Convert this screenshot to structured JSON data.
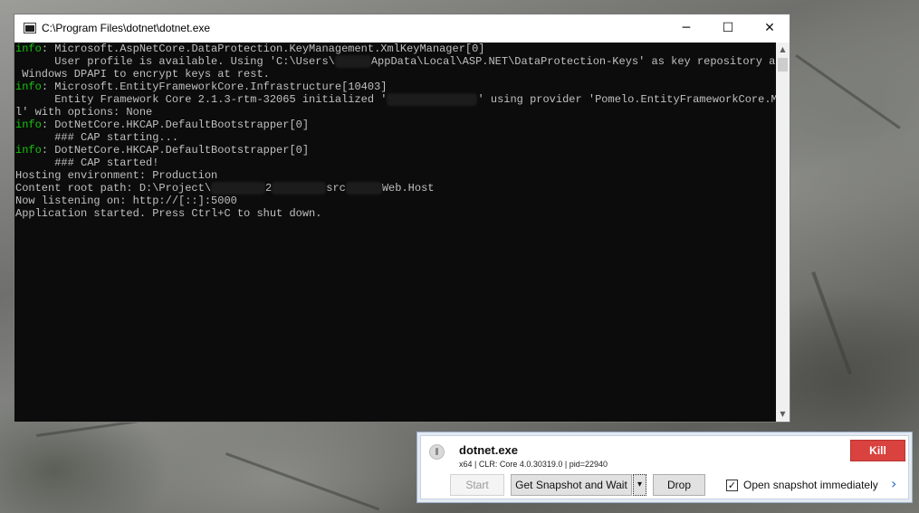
{
  "window": {
    "title": "C:\\Program Files\\dotnet\\dotnet.exe",
    "minimize_glyph": "─",
    "maximize_glyph": "☐",
    "close_glyph": "✕"
  },
  "console": {
    "lines": [
      [
        {
          "t": "info",
          "c": "info"
        },
        {
          "t": ": Microsoft.AspNetCore.DataProtection.KeyManagement.XmlKeyManager[0]"
        }
      ],
      [
        {
          "t": "      User profile is available. Using 'C:\\Users\\"
        },
        {
          "r": 40
        },
        {
          "t": "AppData\\Local\\ASP.NET\\DataProtection-Keys' as key repository and"
        }
      ],
      [
        {
          "t": " Windows DPAPI to encrypt keys at rest."
        }
      ],
      [
        {
          "t": "info",
          "c": "info"
        },
        {
          "t": ": Microsoft.EntityFrameworkCore.Infrastructure[10403]"
        }
      ],
      [
        {
          "t": "      Entity Framework Core 2.1.3-rtm-32065 initialized '"
        },
        {
          "r": 100
        },
        {
          "t": "' using provider 'Pomelo.EntityFrameworkCore.MySq"
        }
      ],
      [
        {
          "t": "l' with options: None"
        }
      ],
      [
        {
          "t": "info",
          "c": "info"
        },
        {
          "t": ": DotNetCore.HKCAP.DefaultBootstrapper[0]"
        }
      ],
      [
        {
          "t": "      ### CAP starting..."
        }
      ],
      [
        {
          "t": "info",
          "c": "info"
        },
        {
          "t": ": DotNetCore.HKCAP.DefaultBootstrapper[0]"
        }
      ],
      [
        {
          "t": "      ### CAP started!"
        }
      ],
      [
        {
          "t": "Hosting environment: Production"
        }
      ],
      [
        {
          "t": "Content root path: D:\\Project\\"
        },
        {
          "r": 60
        },
        {
          "t": "2"
        },
        {
          "r": 60
        },
        {
          "t": "src"
        },
        {
          "r": 40
        },
        {
          "t": "Web.Host"
        }
      ],
      [
        {
          "t": "Now listening on: http://[::]:5000"
        }
      ],
      [
        {
          "t": "Application started. Press Ctrl+C to shut down."
        }
      ]
    ]
  },
  "scrollbar": {
    "up_glyph": "▲",
    "down_glyph": "▼"
  },
  "snapshot_panel": {
    "process_name": "dotnet.exe",
    "process_info": "x64 | CLR: Core 4.0.30319.0 | pid=22940",
    "kill_label": "Kill",
    "start_label": "Start",
    "snapshot_label": "Get Snapshot and Wait",
    "dropdown_glyph": "▾",
    "drop_label": "Drop",
    "open_snapshot_checked": true,
    "check_glyph": "✓",
    "open_snapshot_label": "Open snapshot immediately",
    "more_glyph": "›"
  },
  "colors": {
    "console_bg": "#0c0c0c",
    "console_text": "#c0c0c0",
    "info_green": "#16c60c",
    "kill_red": "#d9423f",
    "accent_blue": "#2b6cc4"
  }
}
